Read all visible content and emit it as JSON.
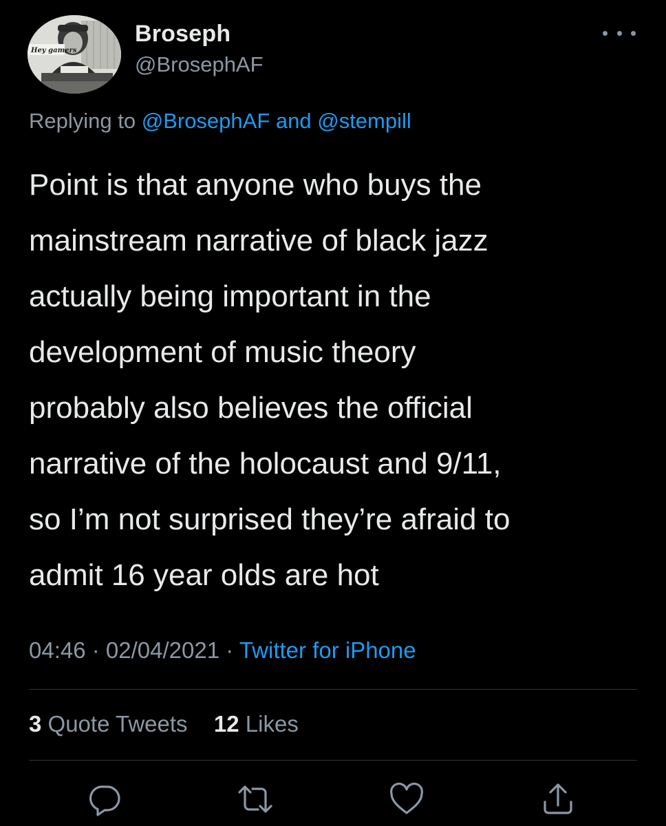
{
  "author": {
    "display_name": "Broseph",
    "handle": "@BrosephAF",
    "avatar_caption": "Hey gamers"
  },
  "reply": {
    "prefix": "Replying to ",
    "mention1": "@BrosephAF",
    "joiner": " and ",
    "mention2": "@stempill"
  },
  "tweet": {
    "lines": [
      "Point is that anyone who buys the",
      "mainstream narrative of black jazz",
      "actually being important in the",
      "development of music theory",
      "probably also believes the official",
      "narrative of the holocaust and 9/11,",
      "so I’m not surprised they’re afraid to",
      "admit 16 year olds are hot"
    ]
  },
  "meta": {
    "time": "04:46",
    "sep1": " · ",
    "date": "02/04/2021",
    "sep2": " · ",
    "source": "Twitter for iPhone"
  },
  "stats": {
    "quotes_count": "3",
    "quotes_label": " Quote Tweets",
    "likes_count": "12",
    "likes_label": " Likes"
  },
  "actions": [
    {
      "name": "reply",
      "icon": "comment-icon"
    },
    {
      "name": "retweet",
      "icon": "retweet-icon"
    },
    {
      "name": "like",
      "icon": "heart-icon"
    },
    {
      "name": "share",
      "icon": "share-icon"
    }
  ],
  "colors": {
    "background": "#000000",
    "text": "#e7e9ea",
    "secondary": "#8b98a5",
    "accent": "#1d9bf0",
    "divider": "#2f3336"
  }
}
